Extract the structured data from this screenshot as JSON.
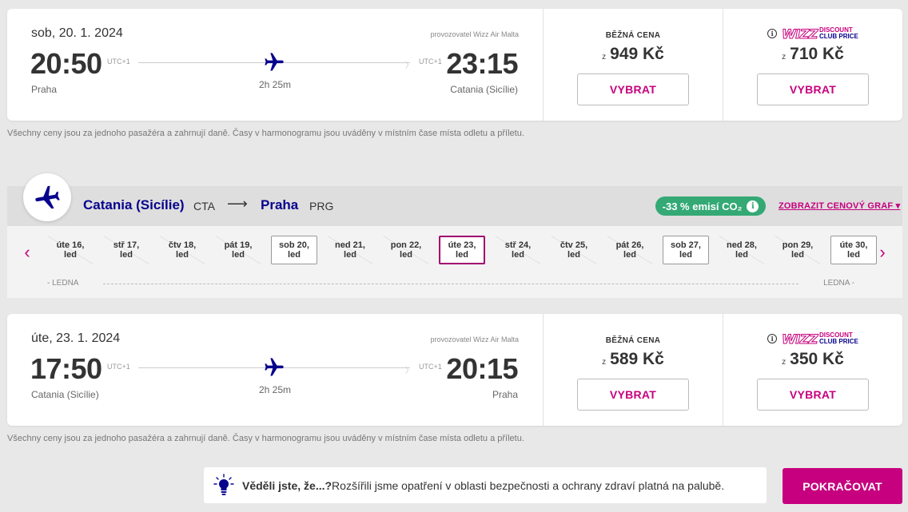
{
  "outbound": {
    "date": "sob, 20. 1. 2024",
    "operator": "provozovatel Wizz Air Malta",
    "dep_time": "20:50",
    "dep_tz": "UTC+1",
    "arr_time": "23:15",
    "arr_tz": "UTC+1",
    "dep_city": "Praha",
    "arr_city": "Catania (Sicílie)",
    "duration": "2h 25m",
    "regular": {
      "label": "BĚŽNÁ CENA",
      "prefix": "z",
      "price": "949 Kč",
      "button": "VYBRAT"
    },
    "club": {
      "logo_wizz": "WIZZ",
      "logo_line1": "DISCOUNT",
      "logo_line2": "CLUB PRICE",
      "prefix": "z",
      "price": "710 Kč",
      "button": "VYBRAT"
    },
    "note": "Všechny ceny jsou za jednoho pasažéra a zahrnují daně. Časy v harmonogramu jsou uváděny v místním čase místa odletu a příletu."
  },
  "return_route": {
    "from": "Catania (Sicílie)",
    "from_code": "CTA",
    "arrow": "⟶",
    "to": "Praha",
    "to_code": "PRG",
    "co2": "-33 % emisí CO₂",
    "price_graph": "ZOBRAZIT CENOVÝ GRAF ▾"
  },
  "date_strip": {
    "dates": [
      {
        "line1": "úte 16,",
        "line2": "led",
        "state": "disabled"
      },
      {
        "line1": "stř 17,",
        "line2": "led",
        "state": "disabled"
      },
      {
        "line1": "čtv 18,",
        "line2": "led",
        "state": "disabled"
      },
      {
        "line1": "pát 19,",
        "line2": "led",
        "state": "disabled"
      },
      {
        "line1": "sob 20,",
        "line2": "led",
        "state": "avail"
      },
      {
        "line1": "ned 21,",
        "line2": "led",
        "state": "disabled"
      },
      {
        "line1": "pon 22,",
        "line2": "led",
        "state": "disabled"
      },
      {
        "line1": "úte 23,",
        "line2": "led",
        "state": "selected"
      },
      {
        "line1": "stř 24,",
        "line2": "led",
        "state": "disabled"
      },
      {
        "line1": "čtv 25,",
        "line2": "led",
        "state": "disabled"
      },
      {
        "line1": "pát 26,",
        "line2": "led",
        "state": "disabled"
      },
      {
        "line1": "sob 27,",
        "line2": "led",
        "state": "avail"
      },
      {
        "line1": "ned 28,",
        "line2": "led",
        "state": "disabled"
      },
      {
        "line1": "pon 29,",
        "line2": "led",
        "state": "disabled"
      },
      {
        "line1": "úte 30,",
        "line2": "led",
        "state": "avail"
      }
    ],
    "month_left": "LEDNA",
    "month_right": "LEDNA",
    "prev": "‹",
    "next": "›"
  },
  "inbound": {
    "date": "úte, 23. 1. 2024",
    "operator": "provozovatel Wizz Air Malta",
    "dep_time": "17:50",
    "dep_tz": "UTC+1",
    "arr_time": "20:15",
    "arr_tz": "UTC+1",
    "dep_city": "Catania (Sicílie)",
    "arr_city": "Praha",
    "duration": "2h 25m",
    "regular": {
      "label": "BĚŽNÁ CENA",
      "prefix": "z",
      "price": "589 Kč",
      "button": "VYBRAT"
    },
    "club": {
      "logo_wizz": "WIZZ",
      "logo_line1": "DISCOUNT",
      "logo_line2": "CLUB PRICE",
      "prefix": "z",
      "price": "350 Kč",
      "button": "VYBRAT"
    },
    "note": "Všechny ceny jsou za jednoho pasažéra a zahrnují daně. Časy v harmonogramu jsou uváděny v místním čase místa odletu a příletu."
  },
  "tip": {
    "bold": "Věděli jste, že...?",
    "text": "Rozšířili jsme opatření v oblasti bezpečnosti a ochrany zdraví platná na palubě."
  },
  "continue_button": "POKRAČOVAT",
  "colors": {
    "brand_magenta": "#c6007e",
    "brand_navy": "#06038d",
    "co2_green": "#34a975"
  }
}
